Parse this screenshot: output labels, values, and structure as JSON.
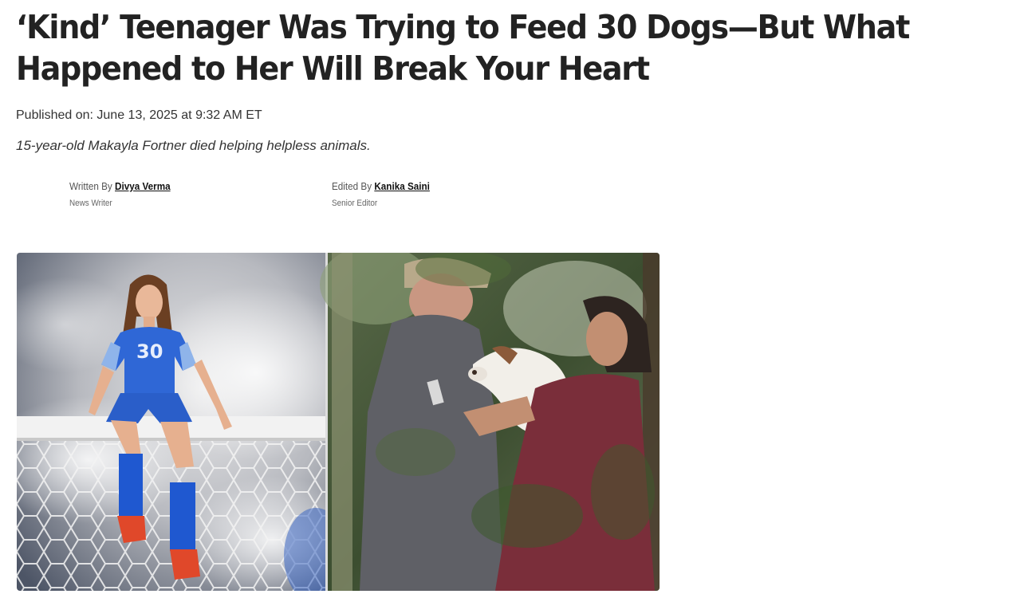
{
  "article": {
    "headline": "‘Kind’ Teenager Was Trying to Feed 30 Dogs—But What Happened to Her Will Break Your Heart",
    "published": "Published on: June 13, 2025 at 9:32 AM ET",
    "subtitle": "15-year-old Makayla Fortner died helping helpless animals."
  },
  "byline": {
    "writer": {
      "prefix": "Written By ",
      "name": "Divya Verma",
      "role": "News Writer"
    },
    "editor": {
      "prefix": "Edited By ",
      "name": "Kanika Saini",
      "role": "Senior Editor"
    }
  },
  "hero_image": {
    "jersey_number": "30",
    "colors": {
      "jersey": "#2f67d6",
      "jersey_sleeve": "#8fb4ea",
      "shoes": "#e0482a",
      "shirt": "#7a2e3a",
      "foliage": "#3d5a2c"
    }
  }
}
